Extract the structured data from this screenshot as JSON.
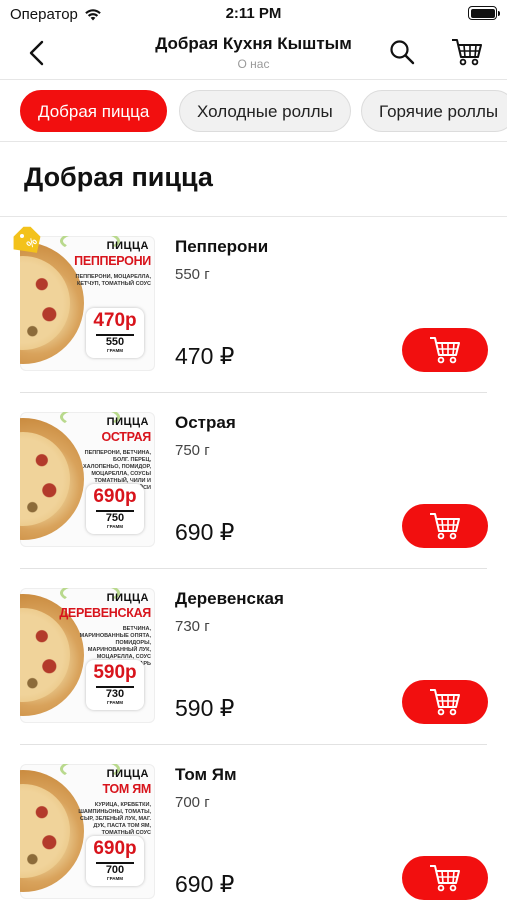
{
  "status_bar": {
    "carrier": "Оператор",
    "time": "2:11 PM"
  },
  "header": {
    "title": "Добрая Кухня Кыштым",
    "subtitle": "О нас"
  },
  "categories": [
    {
      "label": "Добрая пицца",
      "active": true
    },
    {
      "label": "Холодные роллы",
      "active": false
    },
    {
      "label": "Горячие роллы",
      "active": false
    }
  ],
  "section": {
    "title": "Добрая пицца"
  },
  "products": [
    {
      "name": "Пепперони",
      "weight": "550 г",
      "price": "470 ₽",
      "image": {
        "top": "ПИЦЦА",
        "name": "ПЕППЕРОНИ",
        "ingredients": "ПЕППЕРОНИ, МОЦАРЕЛЛА, КЕТЧУП, ТОМАТНЫЙ СОУС",
        "price": "470р",
        "weight": "550",
        "unit": "ГРАММ"
      }
    },
    {
      "name": "Острая",
      "weight": "750 г",
      "price": "690 ₽",
      "image": {
        "top": "ПИЦЦА",
        "name": "ОСТРАЯ",
        "ingredients": "ПЕППЕРОНИ, ВЕТЧИНА, БОЛГ. ПЕРЕЦ, ХАЛОПЕНЬО, ПОМИДОР, МОЦАРЕЛЛА, СОУСЫ ТОМАТНЫЙ, ЧИЛИ И СПАЙСИ",
        "price": "690р",
        "weight": "750",
        "unit": "ГРАММ"
      }
    },
    {
      "name": "Деревенская",
      "weight": "730 г",
      "price": "590 ₽",
      "image": {
        "top": "ПИЦЦА",
        "name": "ДЕРЕВЕНСКАЯ",
        "ingredients": "ВЕТЧИНА, МАРИНОВАННЫЕ ОПЯТА, ПОМИДОРЫ, МАРИНОВАННЫЙ ЛУК, МОЦАРЕЛЛА, СОУС ЦЕЗАРЬ",
        "price": "590р",
        "weight": "730",
        "unit": "ГРАММ"
      }
    },
    {
      "name": "Том Ям",
      "weight": "700 г",
      "price": "690 ₽",
      "image": {
        "top": "ПИЦЦА",
        "name": "ТОМ ЯМ",
        "ingredients": "КУРИЦА, КРЕВЕТКИ, ШАМПИНЬОНЫ, ТОМАТЫ, СЫР, ЗЕЛЕНЫЙ ЛУК, МАГ. ДУК, ПАСТА ТОМ ЯМ, ТОМАТНЫЙ СОУС",
        "price": "690р",
        "weight": "700",
        "unit": "ГРАММ"
      }
    }
  ],
  "colors": {
    "accent": "#f20f0f",
    "tag": "#f3c21b"
  },
  "icons": {
    "back": "chevron-left-icon",
    "search": "search-icon",
    "cart": "cart-icon",
    "discount": "discount-tag-icon"
  }
}
